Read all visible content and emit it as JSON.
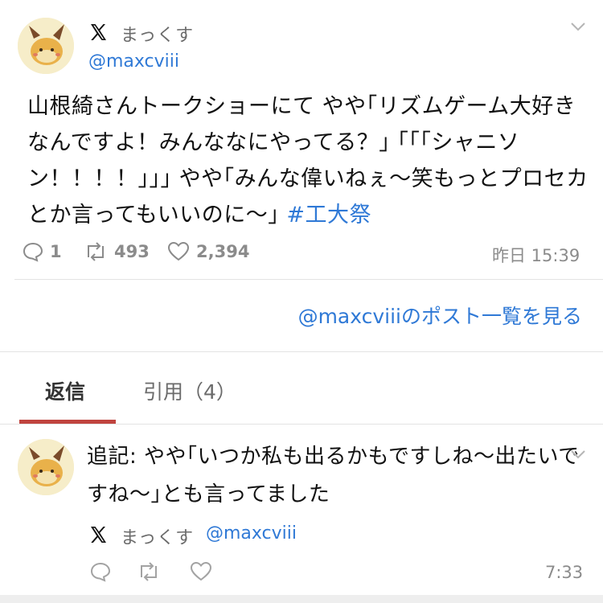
{
  "tweet": {
    "display_name": "まっくす",
    "handle": "@maxcviii",
    "text": "山根綺さんトークショーにて やや｢リズムゲーム大好きなんですよ！みんななにやってる？｣ ｢｢｢シャニソン！！！！｣｣｣ やや｢みんな偉いねぇ〜笑もっとプロセカとか言ってもいいのに〜｣ ",
    "hashtag": "#工大祭",
    "reply_count": "1",
    "retweet_count": "493",
    "like_count": "2,394",
    "timestamp": "昨日 15:39"
  },
  "view_more_link": "@maxcviiiのポスト一覧を見る",
  "tabs": [
    {
      "label": "返信",
      "active": true
    },
    {
      "label": "引用（4）",
      "active": false
    }
  ],
  "reply": {
    "text": "追記: やや｢いつか私も出るかもですしね〜出たいですね〜｣とも言ってました",
    "display_name": "まっくす",
    "handle": "@maxcviii",
    "timestamp": "7:33"
  },
  "colors": {
    "link": "#2f79d6",
    "accent": "#c0443f",
    "muted": "#8b8b8b"
  },
  "icons": [
    "avatar",
    "x-logo-icon",
    "chevron-down-icon",
    "reply-icon",
    "retweet-icon",
    "like-icon"
  ]
}
